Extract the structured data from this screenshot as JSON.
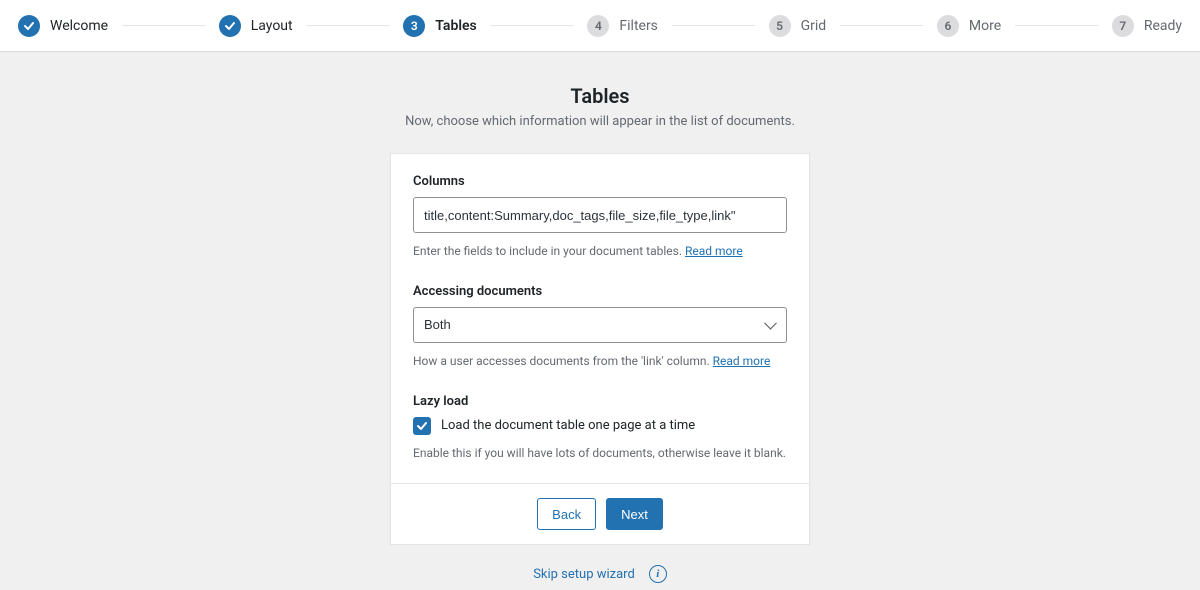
{
  "stepper": {
    "steps": [
      {
        "label": "Welcome",
        "state": "done"
      },
      {
        "label": "Layout",
        "state": "done"
      },
      {
        "label": "Tables",
        "state": "active",
        "number": "3"
      },
      {
        "label": "Filters",
        "state": "future",
        "number": "4"
      },
      {
        "label": "Grid",
        "state": "future",
        "number": "5"
      },
      {
        "label": "More",
        "state": "future",
        "number": "6"
      },
      {
        "label": "Ready",
        "state": "future",
        "number": "7"
      }
    ]
  },
  "header": {
    "title": "Tables",
    "subtitle": "Now, choose which information will appear in the list of documents."
  },
  "form": {
    "columns": {
      "label": "Columns",
      "value": "title,content:Summary,doc_tags,file_size,file_type,link\"",
      "help_prefix": "Enter the fields to include in your document tables. ",
      "help_link": "Read more"
    },
    "accessing": {
      "label": "Accessing documents",
      "value": "Both",
      "help_prefix": "How a user accesses documents from the 'link' column. ",
      "help_link": "Read more"
    },
    "lazy": {
      "label": "Lazy load",
      "checkbox_label": "Load the document table one page at a time",
      "checked": true,
      "help": "Enable this if you will have lots of documents, otherwise leave it blank."
    }
  },
  "footer": {
    "back": "Back",
    "next": "Next",
    "skip": "Skip setup wizard"
  }
}
